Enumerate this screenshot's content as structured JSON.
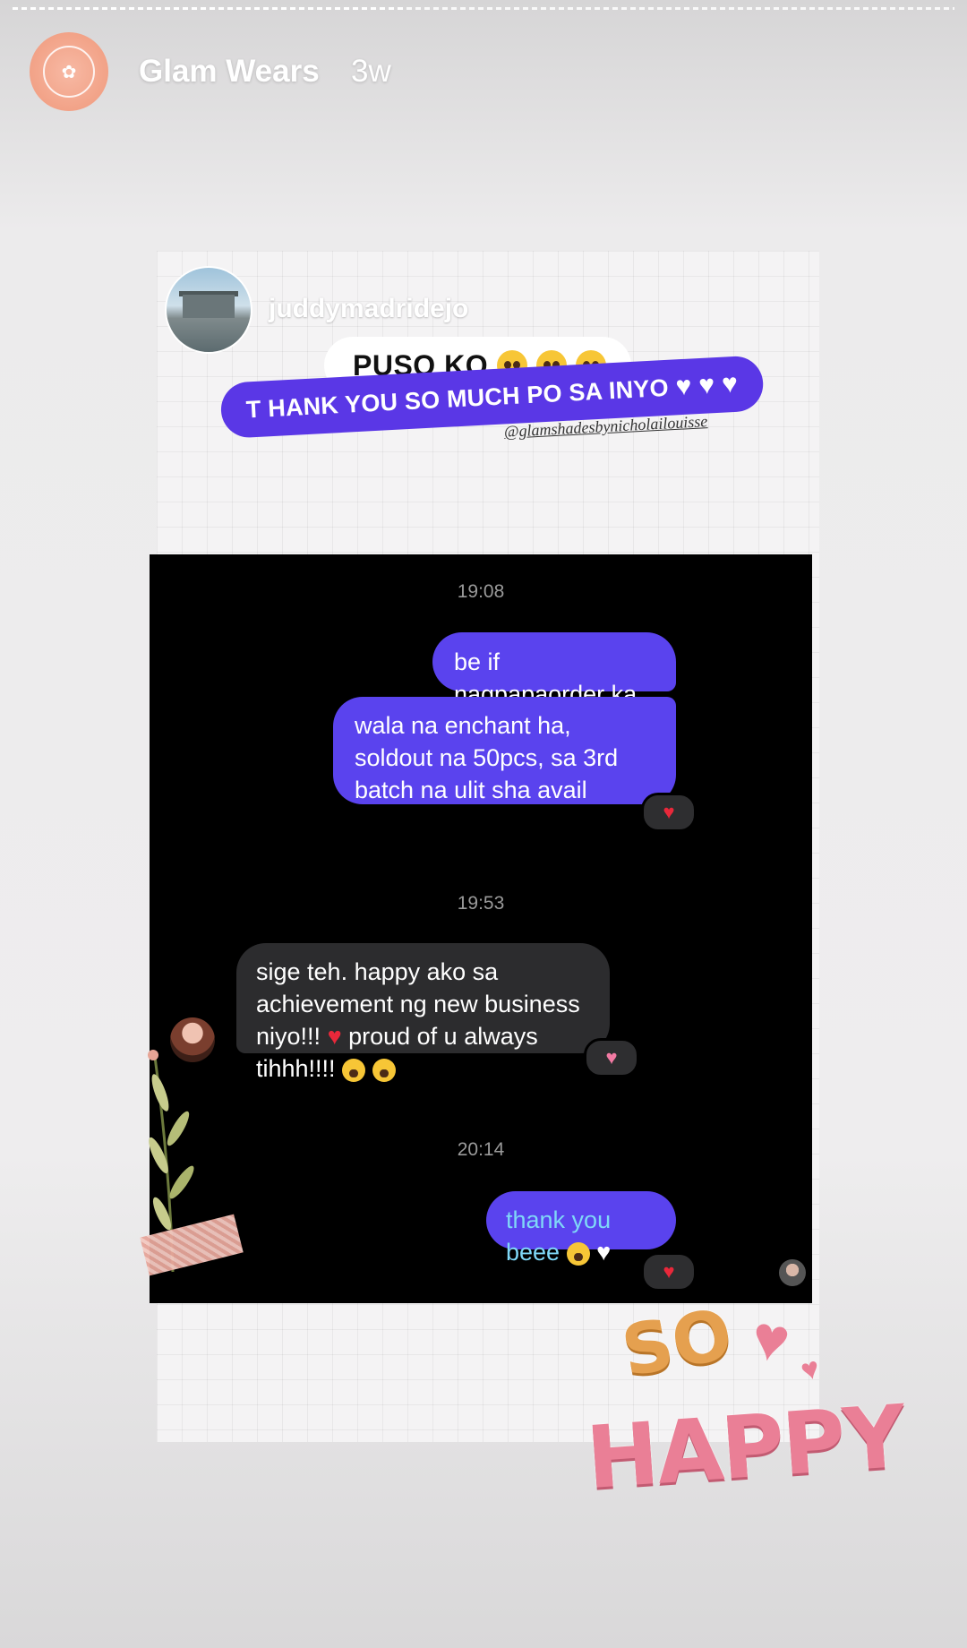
{
  "story": {
    "account_name": "Glam Wears",
    "time_ago": "3w"
  },
  "reply_sticker": {
    "username": "juddymadridejo",
    "line1": "PUSO KO",
    "line2": "T HANK YOU SO MUCH PO SA INYO",
    "watermark": "@glamshadesbynicholailouisse"
  },
  "chat": {
    "messages": [
      {
        "type": "timestamp",
        "text": "19:08"
      },
      {
        "type": "outgoing",
        "text": "be if nagpapaorder ka pa"
      },
      {
        "type": "outgoing",
        "text": "wala na enchant ha, soldout na 50pcs, sa 3rd batch na ulit sha avail",
        "reaction": "red-heart"
      },
      {
        "type": "timestamp",
        "text": "19:53"
      },
      {
        "type": "incoming",
        "text_part1": "sige teh. happy ako sa achievement ng new business niyo!!!",
        "text_part2": "proud of u always tihhh!!!!",
        "reaction": "pink-heart"
      },
      {
        "type": "timestamp",
        "text": "20:14"
      },
      {
        "type": "outgoing",
        "text": "thank you beee",
        "reaction": "red-heart"
      }
    ]
  },
  "sticker": {
    "word1": "SO",
    "word2": "HAPPY"
  },
  "colors": {
    "outgoing_bubble": "#5a43ee",
    "incoming_bubble": "#2c2c2e",
    "thank_pill": "#5a37e6",
    "avatar_ring": "#f2a287"
  },
  "icons": [
    "glam-wears-logo-icon",
    "red-heart-icon",
    "pink-heart-icon",
    "white-heart-icon",
    "pleading-face-icon",
    "kiss-face-icon"
  ]
}
